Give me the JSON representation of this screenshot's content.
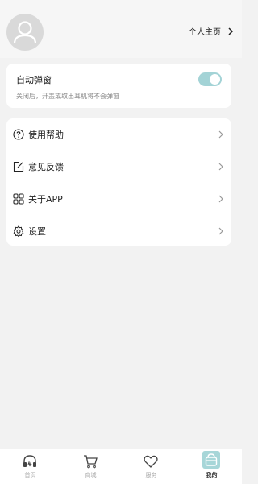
{
  "profile": {
    "link_label": "个人主页"
  },
  "popup_setting": {
    "title": "自动弹窗",
    "description": "关闭后，开盖或取出耳机将不会弹窗",
    "enabled": true
  },
  "menu": [
    {
      "label": "使用帮助",
      "icon": "help-circle-icon"
    },
    {
      "label": "意见反馈",
      "icon": "feedback-edit-icon"
    },
    {
      "label": "关于APP",
      "icon": "grid-icon"
    },
    {
      "label": "设置",
      "icon": "gear-icon"
    }
  ],
  "tabs": [
    {
      "label": "首页",
      "icon": "headphones-icon"
    },
    {
      "label": "商城",
      "icon": "cart-icon"
    },
    {
      "label": "服务",
      "icon": "heart-icon"
    },
    {
      "label": "我的",
      "icon": "user-bag-icon",
      "active": true
    }
  ],
  "colors": {
    "accent": "#a3d3d6",
    "background": "#f2f2f2"
  }
}
